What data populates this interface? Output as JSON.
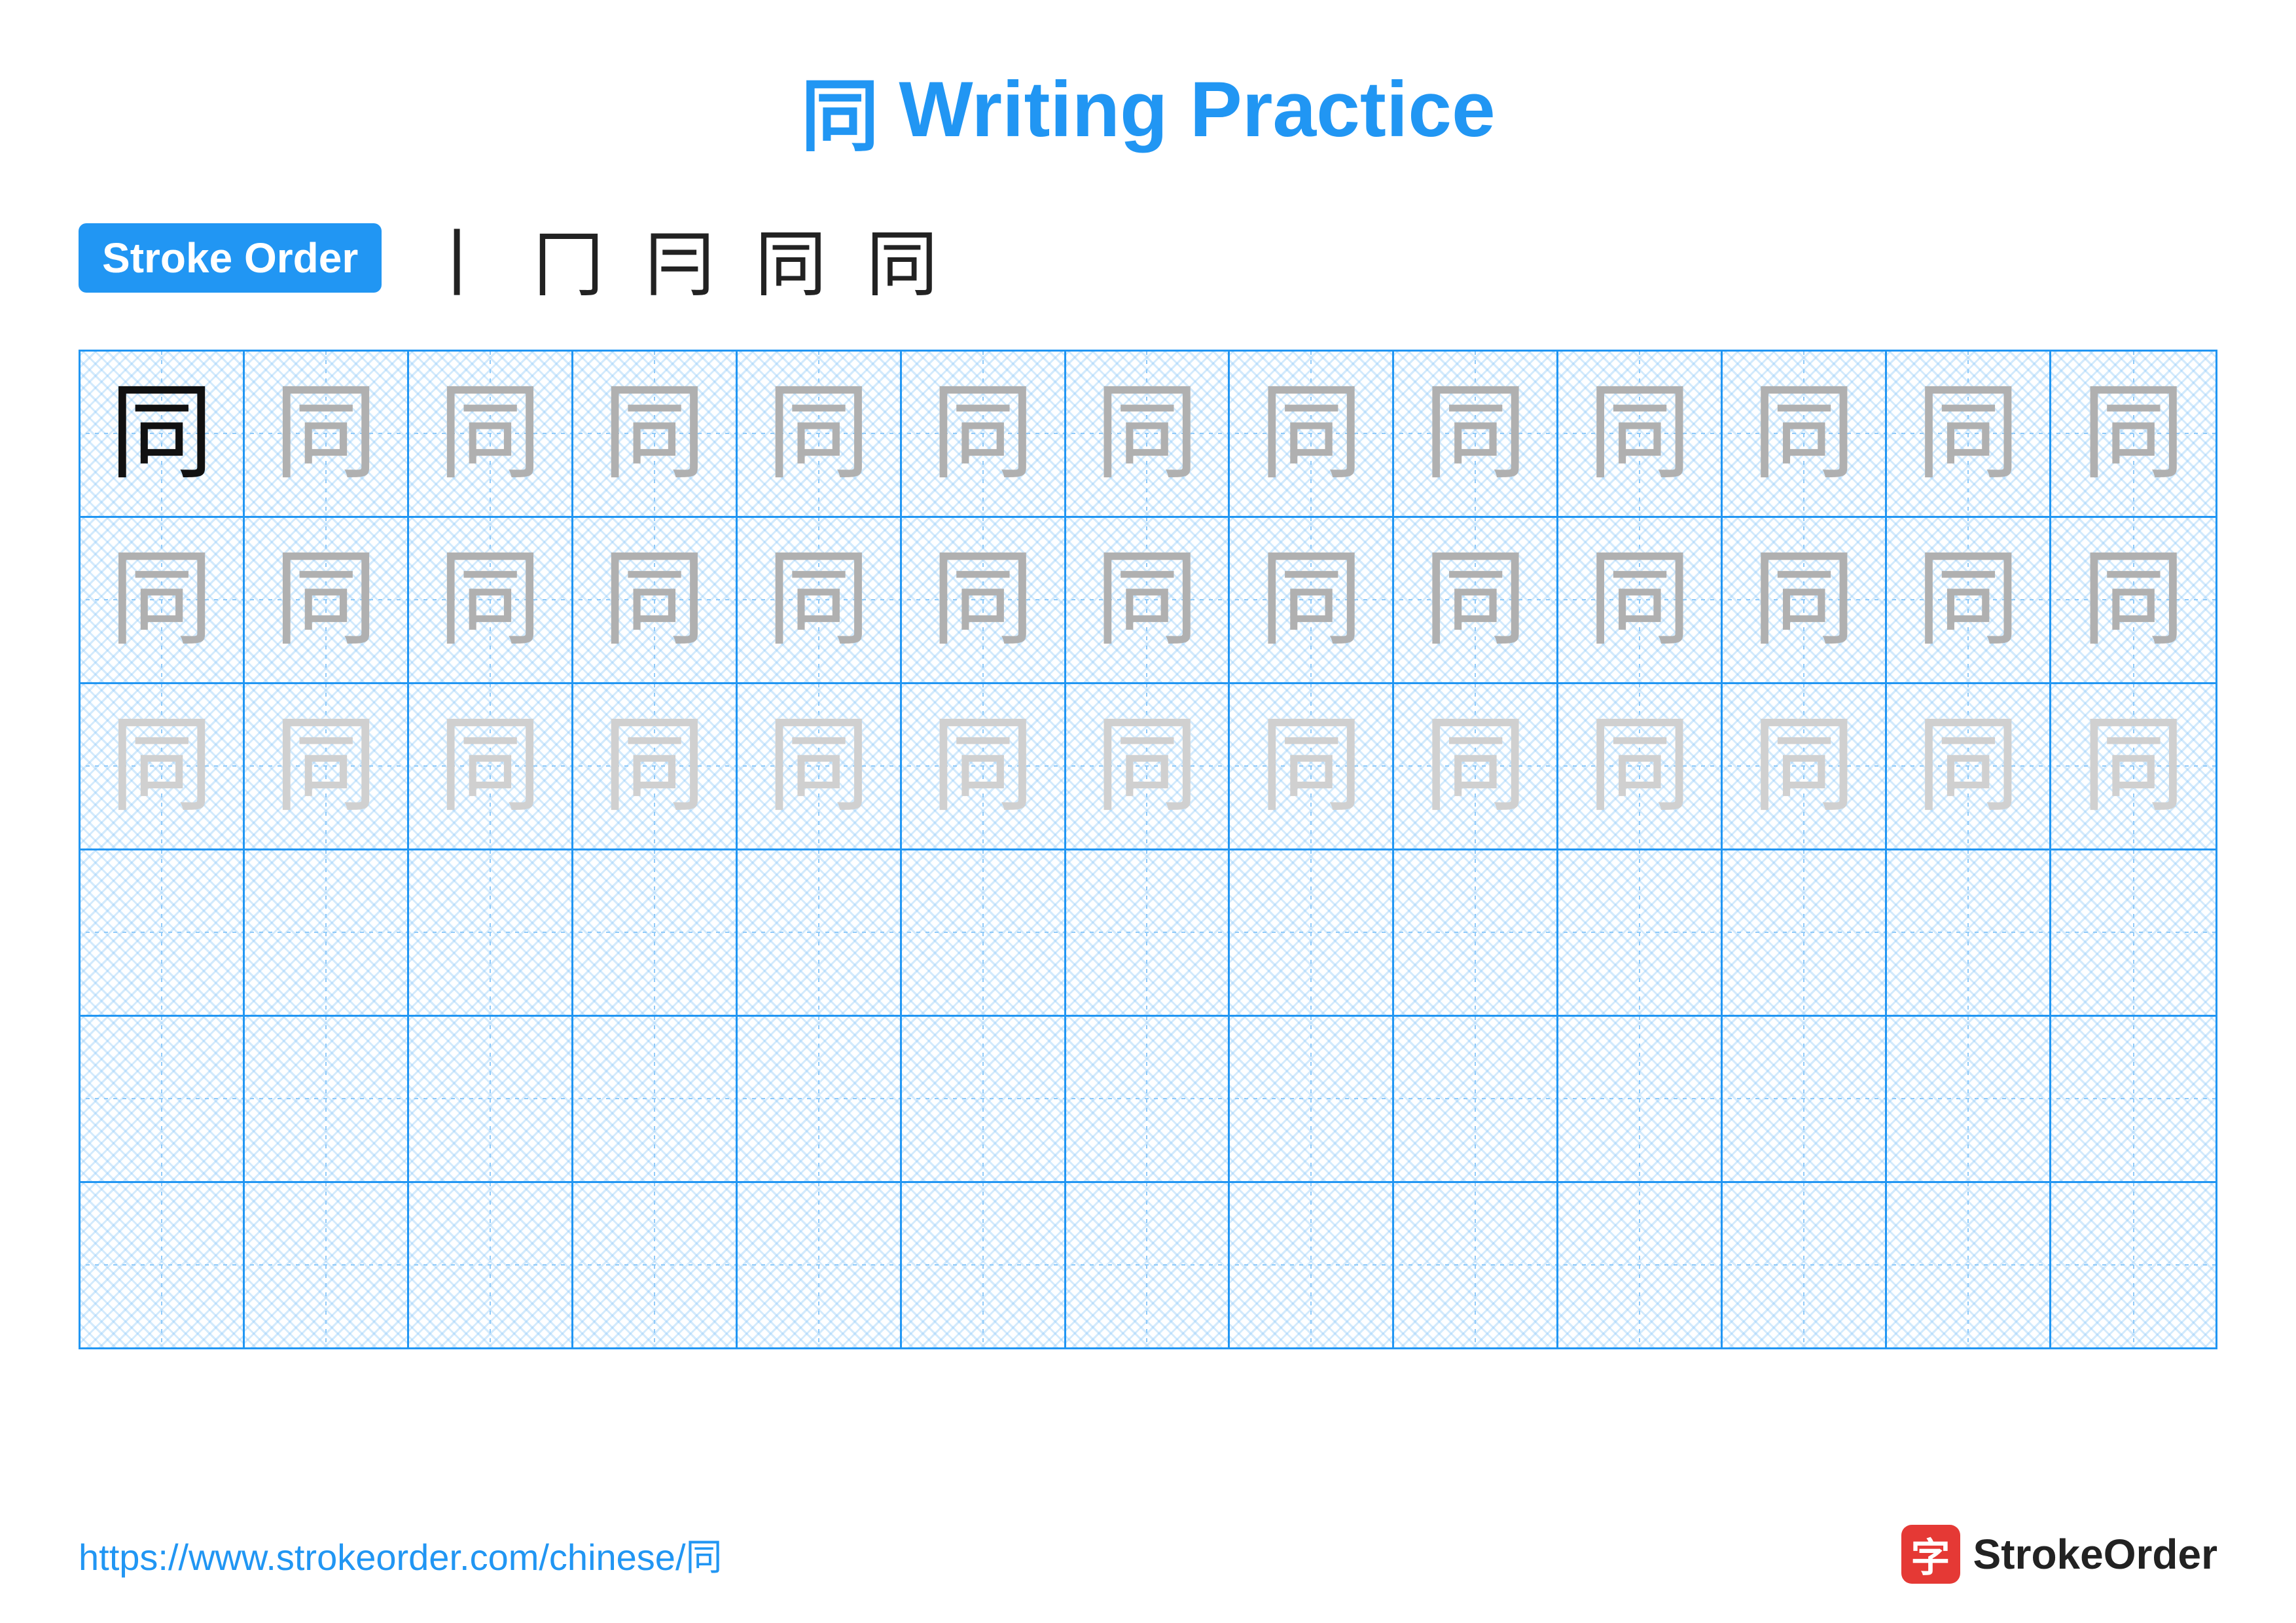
{
  "title": {
    "character": "同",
    "text": "Writing Practice"
  },
  "stroke_order": {
    "badge_label": "Stroke Order",
    "steps": [
      "丨",
      "冂",
      "冃",
      "同",
      "同"
    ]
  },
  "grid": {
    "rows": 6,
    "cols": 13,
    "row_data": [
      {
        "type": "dark-then-fading",
        "chars": [
          "dark",
          "medium",
          "medium",
          "medium",
          "medium",
          "medium",
          "medium",
          "medium",
          "medium",
          "medium",
          "medium",
          "medium",
          "medium"
        ]
      },
      {
        "type": "fading",
        "chars": [
          "medium",
          "medium",
          "medium",
          "medium",
          "medium",
          "medium",
          "medium",
          "medium",
          "medium",
          "medium",
          "medium",
          "medium",
          "medium"
        ]
      },
      {
        "type": "fading",
        "chars": [
          "light",
          "light",
          "light",
          "light",
          "light",
          "light",
          "light",
          "light",
          "light",
          "light",
          "light",
          "light",
          "light"
        ]
      },
      {
        "type": "empty",
        "chars": [
          "",
          "",
          "",
          "",
          "",
          "",
          "",
          "",
          "",
          "",
          "",
          "",
          ""
        ]
      },
      {
        "type": "empty",
        "chars": [
          "",
          "",
          "",
          "",
          "",
          "",
          "",
          "",
          "",
          "",
          "",
          "",
          ""
        ]
      },
      {
        "type": "empty",
        "chars": [
          "",
          "",
          "",
          "",
          "",
          "",
          "",
          "",
          "",
          "",
          "",
          "",
          ""
        ]
      }
    ],
    "character": "同"
  },
  "footer": {
    "url": "https://www.strokeorder.com/chinese/同",
    "brand_name": "StrokeOrder",
    "brand_char": "字"
  }
}
